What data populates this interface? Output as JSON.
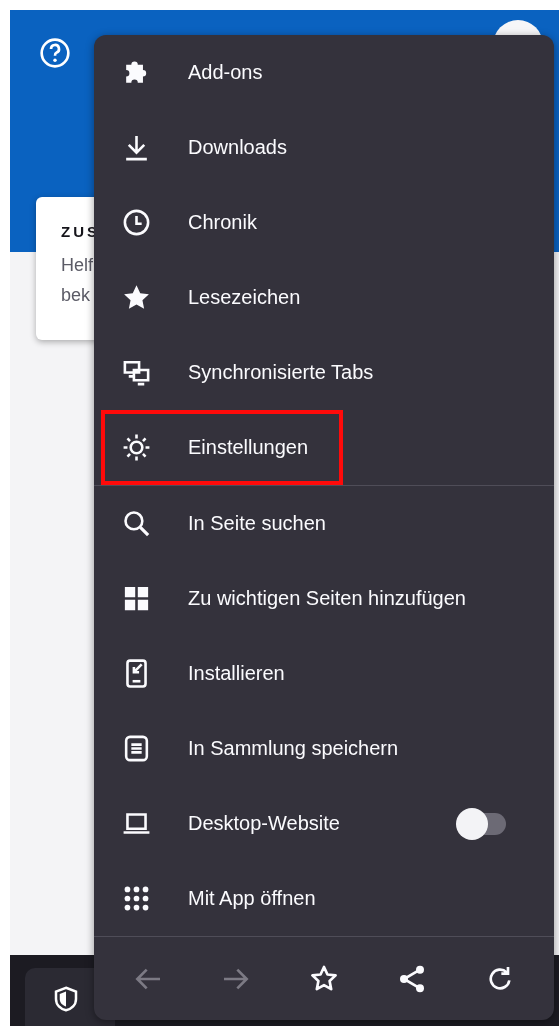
{
  "card": {
    "title": "ZUS",
    "lines": [
      "Helf",
      "bek"
    ]
  },
  "menu": {
    "items": [
      {
        "kind": "link",
        "label": "Add-ons",
        "highlighted": false
      },
      {
        "kind": "link",
        "label": "Downloads",
        "highlighted": false
      },
      {
        "kind": "link",
        "label": "Chronik",
        "highlighted": false
      },
      {
        "kind": "link",
        "label": "Lesezeichen",
        "highlighted": false
      },
      {
        "kind": "link",
        "label": "Synchronisierte Tabs",
        "highlighted": false
      },
      {
        "kind": "link",
        "label": "Einstellungen",
        "highlighted": true
      },
      {
        "kind": "divider"
      },
      {
        "kind": "link",
        "label": "In Seite suchen",
        "highlighted": false
      },
      {
        "kind": "link",
        "label": "Zu wichtigen Seiten hinzufügen",
        "highlighted": false
      },
      {
        "kind": "link",
        "label": "Installieren",
        "highlighted": false
      },
      {
        "kind": "link",
        "label": "In Sammlung speichern",
        "highlighted": false
      },
      {
        "kind": "toggle",
        "label": "Desktop-Website",
        "on": false,
        "highlighted": false
      },
      {
        "kind": "link",
        "label": "Mit App öffnen",
        "highlighted": false
      }
    ],
    "nav": [
      {
        "kind": "back",
        "disabled": true
      },
      {
        "kind": "forward",
        "disabled": true
      },
      {
        "kind": "bookmark",
        "disabled": false
      },
      {
        "kind": "share",
        "disabled": false
      },
      {
        "kind": "reload",
        "disabled": false
      }
    ]
  }
}
